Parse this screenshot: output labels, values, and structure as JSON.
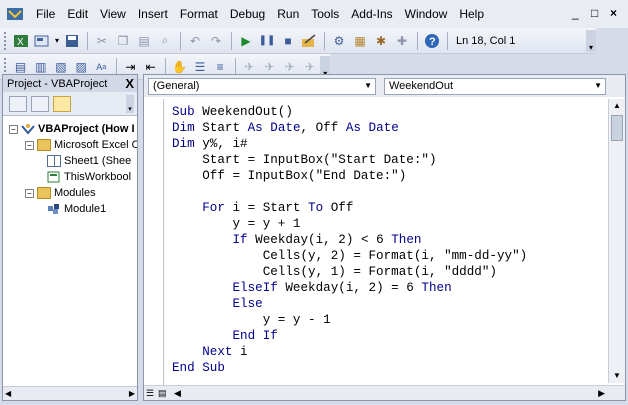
{
  "menu": {
    "items": [
      "File",
      "Edit",
      "View",
      "Insert",
      "Format",
      "Debug",
      "Run",
      "Tools",
      "Add-Ins",
      "Window",
      "Help"
    ],
    "window_controls": [
      "_",
      "□",
      "×"
    ]
  },
  "toolbar": {
    "position_text": "Ln 18, Col 1"
  },
  "project": {
    "title": "Project - VBAProject",
    "close": "X",
    "tree": [
      {
        "label": "VBAProject (How I",
        "level": "root",
        "icon": "vba-project-icon"
      },
      {
        "label": "Microsoft Excel O",
        "level": "folder",
        "icon": "folder-icon"
      },
      {
        "label": "Sheet1 (Shee",
        "level": "item",
        "icon": "sheet-icon"
      },
      {
        "label": "ThisWorkbool",
        "level": "item",
        "icon": "workbook-icon"
      },
      {
        "label": "Modules",
        "level": "folder",
        "icon": "folder-icon"
      },
      {
        "label": "Module1",
        "level": "item",
        "icon": "module-icon"
      }
    ]
  },
  "code": {
    "object_dropdown": "(General)",
    "proc_dropdown": "WeekendOut",
    "lines": [
      [
        {
          "t": "Sub ",
          "k": 1
        },
        {
          "t": "WeekendOut()",
          "k": 0
        }
      ],
      [
        {
          "t": "Dim ",
          "k": 1
        },
        {
          "t": "Start ",
          "k": 0
        },
        {
          "t": "As Date",
          "k": 1
        },
        {
          "t": ", Off ",
          "k": 0
        },
        {
          "t": "As Date",
          "k": 1
        }
      ],
      [
        {
          "t": "Dim ",
          "k": 1
        },
        {
          "t": "y%, i#",
          "k": 0
        }
      ],
      [
        {
          "t": "    Start = InputBox(\"Start Date:\")",
          "k": 0
        }
      ],
      [
        {
          "t": "    Off = InputBox(\"End Date:\")",
          "k": 0
        }
      ],
      [
        {
          "t": "",
          "k": 0
        }
      ],
      [
        {
          "t": "    ",
          "k": 0
        },
        {
          "t": "For ",
          "k": 1
        },
        {
          "t": "i = Start ",
          "k": 0
        },
        {
          "t": "To ",
          "k": 1
        },
        {
          "t": "Off",
          "k": 0
        }
      ],
      [
        {
          "t": "        y = y + 1",
          "k": 0
        }
      ],
      [
        {
          "t": "        ",
          "k": 0
        },
        {
          "t": "If ",
          "k": 1
        },
        {
          "t": "Weekday(i, 2) < 6 ",
          "k": 0
        },
        {
          "t": "Then",
          "k": 1
        }
      ],
      [
        {
          "t": "            Cells(y, 2) = Format(i, \"mm-dd-yy\")",
          "k": 0
        }
      ],
      [
        {
          "t": "            Cells(y, 1) = Format(i, \"dddd\")",
          "k": 0
        }
      ],
      [
        {
          "t": "        ",
          "k": 0
        },
        {
          "t": "ElseIf ",
          "k": 1
        },
        {
          "t": "Weekday(i, 2) = 6 ",
          "k": 0
        },
        {
          "t": "Then",
          "k": 1
        }
      ],
      [
        {
          "t": "        ",
          "k": 0
        },
        {
          "t": "Else",
          "k": 1
        }
      ],
      [
        {
          "t": "            y = y - 1",
          "k": 0
        }
      ],
      [
        {
          "t": "        ",
          "k": 0
        },
        {
          "t": "End If",
          "k": 1
        }
      ],
      [
        {
          "t": "    ",
          "k": 0
        },
        {
          "t": "Next ",
          "k": 1
        },
        {
          "t": "i",
          "k": 0
        }
      ],
      [
        {
          "t": "End Sub",
          "k": 1
        }
      ]
    ]
  },
  "colors": {
    "keyword": "#00008b",
    "background": "#d6dbe9"
  }
}
